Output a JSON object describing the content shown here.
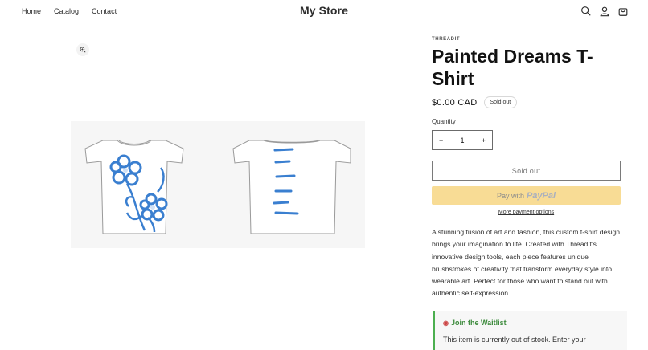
{
  "header": {
    "nav": [
      "Home",
      "Catalog",
      "Contact"
    ],
    "store_name": "My Store",
    "icons": [
      "search-icon",
      "account-icon",
      "cart-icon"
    ]
  },
  "product": {
    "vendor": "THREADIT",
    "title": "Painted Dreams T-Shirt",
    "price": "$0.00 CAD",
    "badge": "Sold out",
    "quantity_label": "Quantity",
    "quantity": "1",
    "decrease": "−",
    "increase": "+",
    "soldout_button": "Sold out",
    "paypal_prefix": "Pay with",
    "paypal_brand": "PayPal",
    "more_payment": "More payment options",
    "description": "A stunning fusion of art and fashion, this custom t-shirt design brings your imagination to life. Created with ThreadIt's innovative design tools, each piece features unique brushstrokes of creativity that transform everyday style into wearable art. Perfect for those who want to stand out with authentic self-expression."
  },
  "waitlist": {
    "title": "Join the Waitlist",
    "text": "This item is currently out of stock. Enter your"
  },
  "colors": {
    "accent_green": "#4caf50",
    "paypal_yellow": "#f8dc95",
    "shirt_print_blue": "#3a7fd0"
  }
}
